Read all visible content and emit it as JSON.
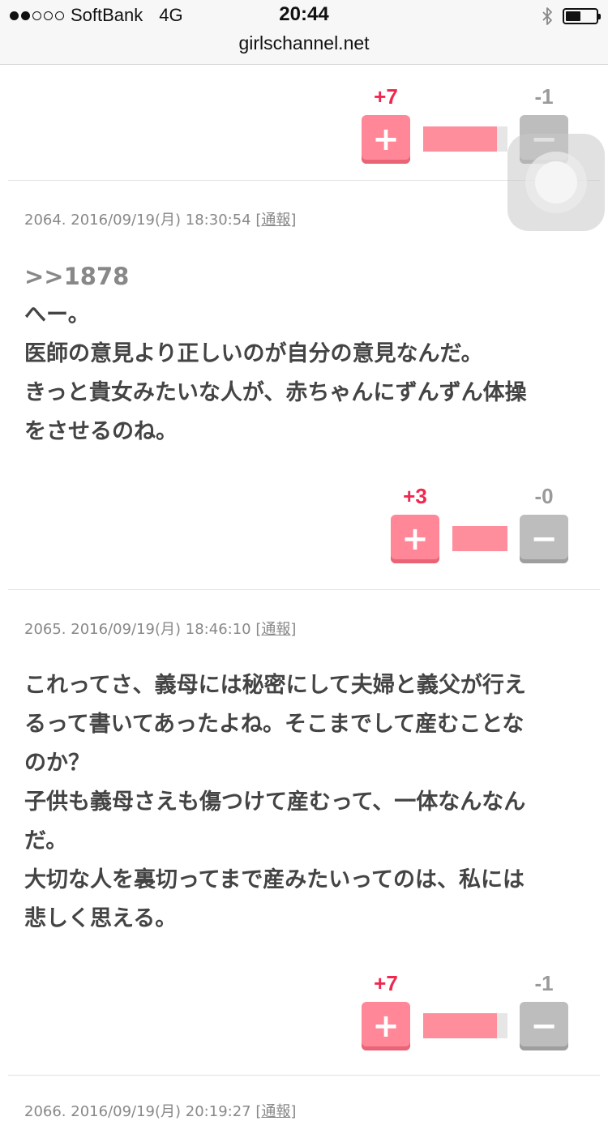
{
  "status_bar": {
    "carrier": "SoftBank",
    "network": "4G",
    "time": "20:44",
    "url": "girlschannel.net",
    "signal_dots": [
      "on",
      "on",
      "off",
      "off",
      "off"
    ],
    "battery_level": 0.5
  },
  "comments": [
    {
      "number": "",
      "date": "",
      "report_label": "",
      "anchor": "",
      "lines": [],
      "plus": "+7",
      "minus": "-1",
      "plus_ratio": 0.875
    },
    {
      "number": "2064.",
      "date": "2016/09/19(月) 18:30:54",
      "report_label": "通報",
      "anchor": ">>1878",
      "lines": [
        "へー。",
        "医師の意見より正しいのが自分の意見なんだ。",
        "きっと貴女みたいな人が、赤ちゃんにずんずん体操",
        "をさせるのね。"
      ],
      "plus": "+3",
      "minus": "-0",
      "plus_ratio": 1.0
    },
    {
      "number": "2065.",
      "date": "2016/09/19(月) 18:46:10",
      "report_label": "通報",
      "anchor": "",
      "lines": [
        "これってさ、義母には秘密にして夫婦と義父が行え",
        "るって書いてあったよね。そこまでして産むことな",
        "のか？",
        "子供も義母さえも傷つけて産むって、一体なんなん",
        "だ。",
        "大切な人を裏切ってまで産みたいってのは、私には",
        "悲しく思える。"
      ],
      "plus": "+7",
      "minus": "-1",
      "plus_ratio": 0.875
    },
    {
      "number": "2066.",
      "date": "2016/09/19(月) 20:19:27",
      "report_label": "通報",
      "anchor": "",
      "lines": []
    }
  ],
  "icons": {
    "plus_button": "plus-icon",
    "minus_button": "minus-icon",
    "bluetooth": "bluetooth-icon",
    "assistive_touch": "assistive-touch-icon"
  },
  "colors": {
    "plus_accent": "#f0284f",
    "plus_button": "#ff8797",
    "minus_button": "#bdbdbd",
    "ratio_fill": "#ff8e9d"
  }
}
